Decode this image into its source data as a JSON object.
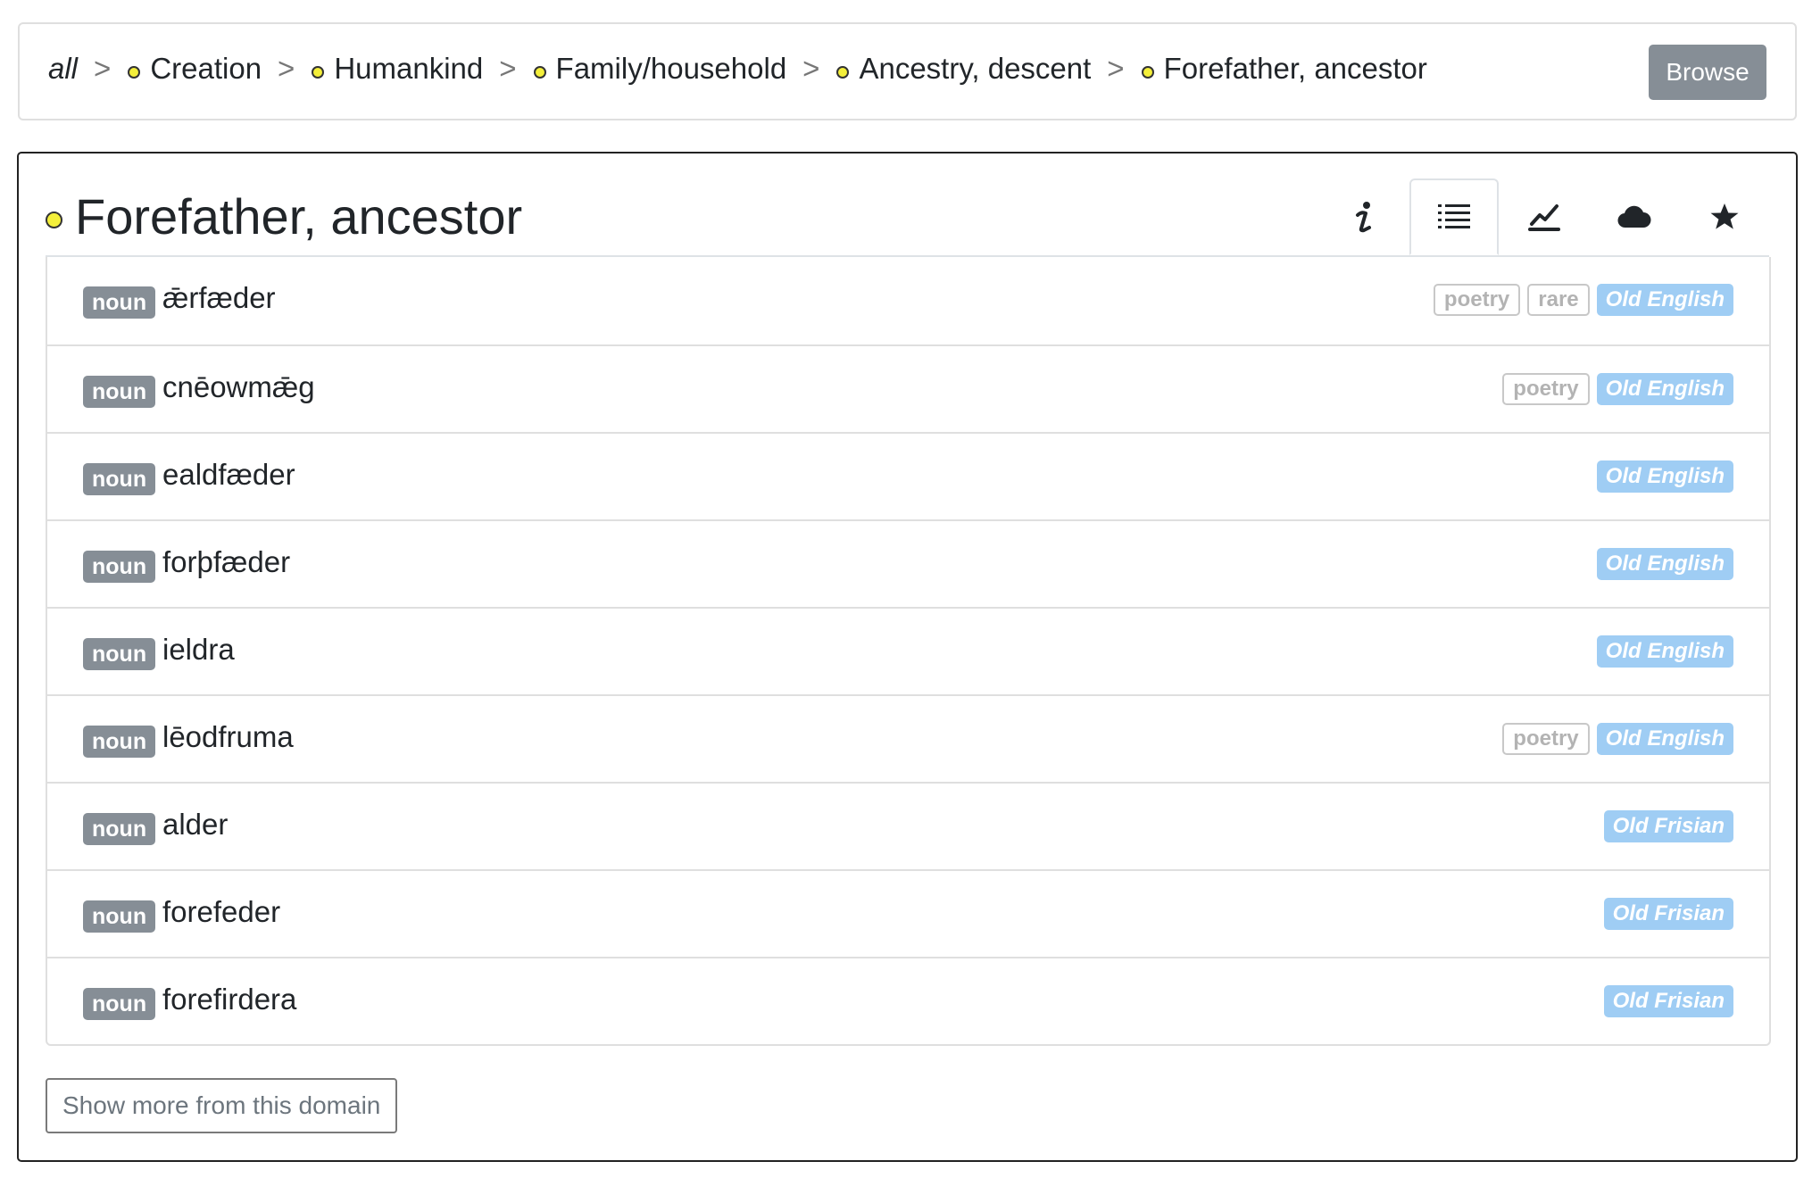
{
  "breadcrumb": {
    "root": "all",
    "separator": ">",
    "items": [
      "Creation",
      "Humankind",
      "Family/household",
      "Ancestry, descent",
      "Forefather, ancestor"
    ],
    "browse_label": "Browse"
  },
  "panel": {
    "title": "Forefather, ancestor",
    "tabs": [
      {
        "icon": "info-icon",
        "active": false
      },
      {
        "icon": "list-icon",
        "active": true
      },
      {
        "icon": "chart-icon",
        "active": false
      },
      {
        "icon": "cloud-icon",
        "active": false
      },
      {
        "icon": "star-icon",
        "active": false
      }
    ],
    "words": [
      {
        "pos": "noun",
        "word": "ǣrfæder",
        "tags": [
          "poetry",
          "rare"
        ],
        "lang": "Old English"
      },
      {
        "pos": "noun",
        "word": "cnēowmǣg",
        "tags": [
          "poetry"
        ],
        "lang": "Old English"
      },
      {
        "pos": "noun",
        "word": "ealdfæder",
        "tags": [],
        "lang": "Old English"
      },
      {
        "pos": "noun",
        "word": "forþfæder",
        "tags": [],
        "lang": "Old English"
      },
      {
        "pos": "noun",
        "word": "ieldra",
        "tags": [],
        "lang": "Old English"
      },
      {
        "pos": "noun",
        "word": "lēodfruma",
        "tags": [
          "poetry"
        ],
        "lang": "Old English"
      },
      {
        "pos": "noun",
        "word": "alder",
        "tags": [],
        "lang": "Old Frisian"
      },
      {
        "pos": "noun",
        "word": "forefeder",
        "tags": [],
        "lang": "Old Frisian"
      },
      {
        "pos": "noun",
        "word": "forefirdera",
        "tags": [],
        "lang": "Old Frisian"
      }
    ],
    "show_more_label": "Show more from this domain"
  },
  "colors": {
    "dot": "#f4ef3a",
    "badge_gray": "#868e96",
    "lang_badge": "#9fcdf4",
    "border": "#dfdfdf"
  }
}
